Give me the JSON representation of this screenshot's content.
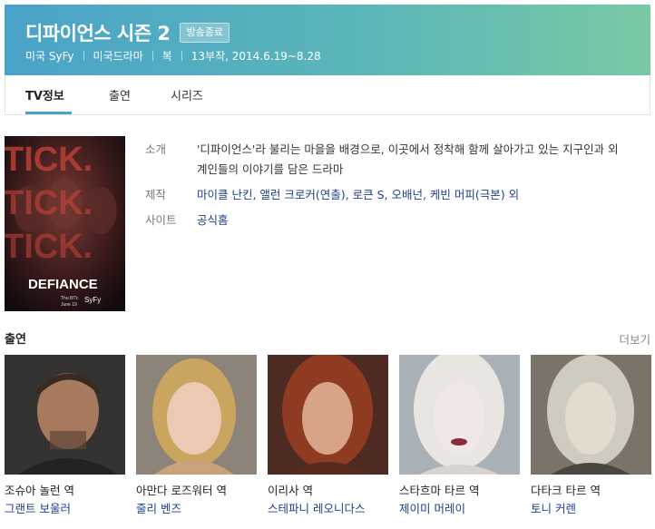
{
  "header": {
    "title": "디파이언스 시즌 2",
    "status_badge": "방송종료",
    "meta": [
      "미국 SyFy",
      "미국드라마",
      "복",
      "13부작, 2014.6.19~8.28"
    ]
  },
  "tabs": [
    {
      "label": "TV정보",
      "active": true
    },
    {
      "label": "출연",
      "active": false
    },
    {
      "label": "시리즈",
      "active": false
    }
  ],
  "poster": {
    "title_lines": [
      "TICK.",
      "TICK.",
      "TICK."
    ],
    "logo": "DEFIANCE",
    "small_text": "Thu 8/7c",
    "date_text": "June 19",
    "network": "SyFy"
  },
  "info": {
    "intro_label": "소개",
    "intro_value": "'디파이언스'라 불리는 마을을 배경으로, 이곳에서 정착해 함께 살아가고 있는 지구인과 외계인들의 이야기를 담은 드라마",
    "production_label": "제작",
    "production_value": "마이클 난킨, 앨런 크로커(연출), 로큰 S, 오배넌, 케빈 머피(극본) 외",
    "site_label": "사이트",
    "site_value": "공식홈"
  },
  "cast_section": {
    "heading": "출연",
    "more_label": "더보기",
    "members": [
      {
        "role": "조슈아 놀런 역",
        "actor": "그랜트 보울러"
      },
      {
        "role": "아만다 로즈워터 역",
        "actor": "줄리 벤즈"
      },
      {
        "role": "이리사 역",
        "actor": "스테파니 레오니다스"
      },
      {
        "role": "스타흐마 타르 역",
        "actor": "제이미 머레이"
      },
      {
        "role": "다타크 타르 역",
        "actor": "토니 커렌"
      }
    ]
  },
  "colors": {
    "header_start": "#4aa3c9",
    "header_end": "#78c9a3",
    "link": "#1f3f88",
    "tab_accent": "#4aa3c9"
  }
}
